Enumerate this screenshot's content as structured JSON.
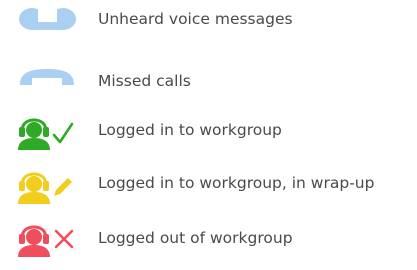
{
  "legend": {
    "items": [
      {
        "label": "Unheard voice messages",
        "icon": "voicemail-icon",
        "color": "#a9d0f0"
      },
      {
        "label": "Missed calls",
        "icon": "phone-handset-icon",
        "color": "#a9d0f0"
      },
      {
        "label": "Logged in to workgroup",
        "icon": "agent-checkmark-icon",
        "color": "#2eaa26"
      },
      {
        "label": "Logged in to workgroup, in wrap-up",
        "icon": "agent-pencil-icon",
        "color": "#f3cd1b"
      },
      {
        "label": "Logged out of workgroup",
        "icon": "agent-x-icon",
        "color": "#ef4e5c"
      }
    ]
  }
}
